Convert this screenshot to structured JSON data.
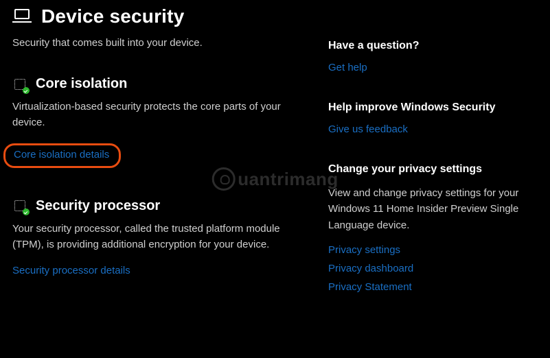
{
  "header": {
    "title": "Device security",
    "subtitle": "Security that comes built into your device."
  },
  "sections": {
    "core_isolation": {
      "title": "Core isolation",
      "desc": "Virtualization-based security protects the core parts of your device.",
      "link": "Core isolation details"
    },
    "security_processor": {
      "title": "Security processor",
      "desc": "Your security processor, called the trusted platform module (TPM), is providing additional encryption for your device.",
      "link": "Security processor details"
    }
  },
  "sidebar": {
    "question": {
      "heading": "Have a question?",
      "link": "Get help"
    },
    "improve": {
      "heading": "Help improve Windows Security",
      "link": "Give us feedback"
    },
    "privacy": {
      "heading": "Change your privacy settings",
      "desc": "View and change privacy settings for your Windows 11 Home Insider Preview Single Language device.",
      "links": {
        "settings": "Privacy settings",
        "dashboard": "Privacy dashboard",
        "statement": "Privacy Statement"
      }
    }
  },
  "watermark": "uantrimang"
}
